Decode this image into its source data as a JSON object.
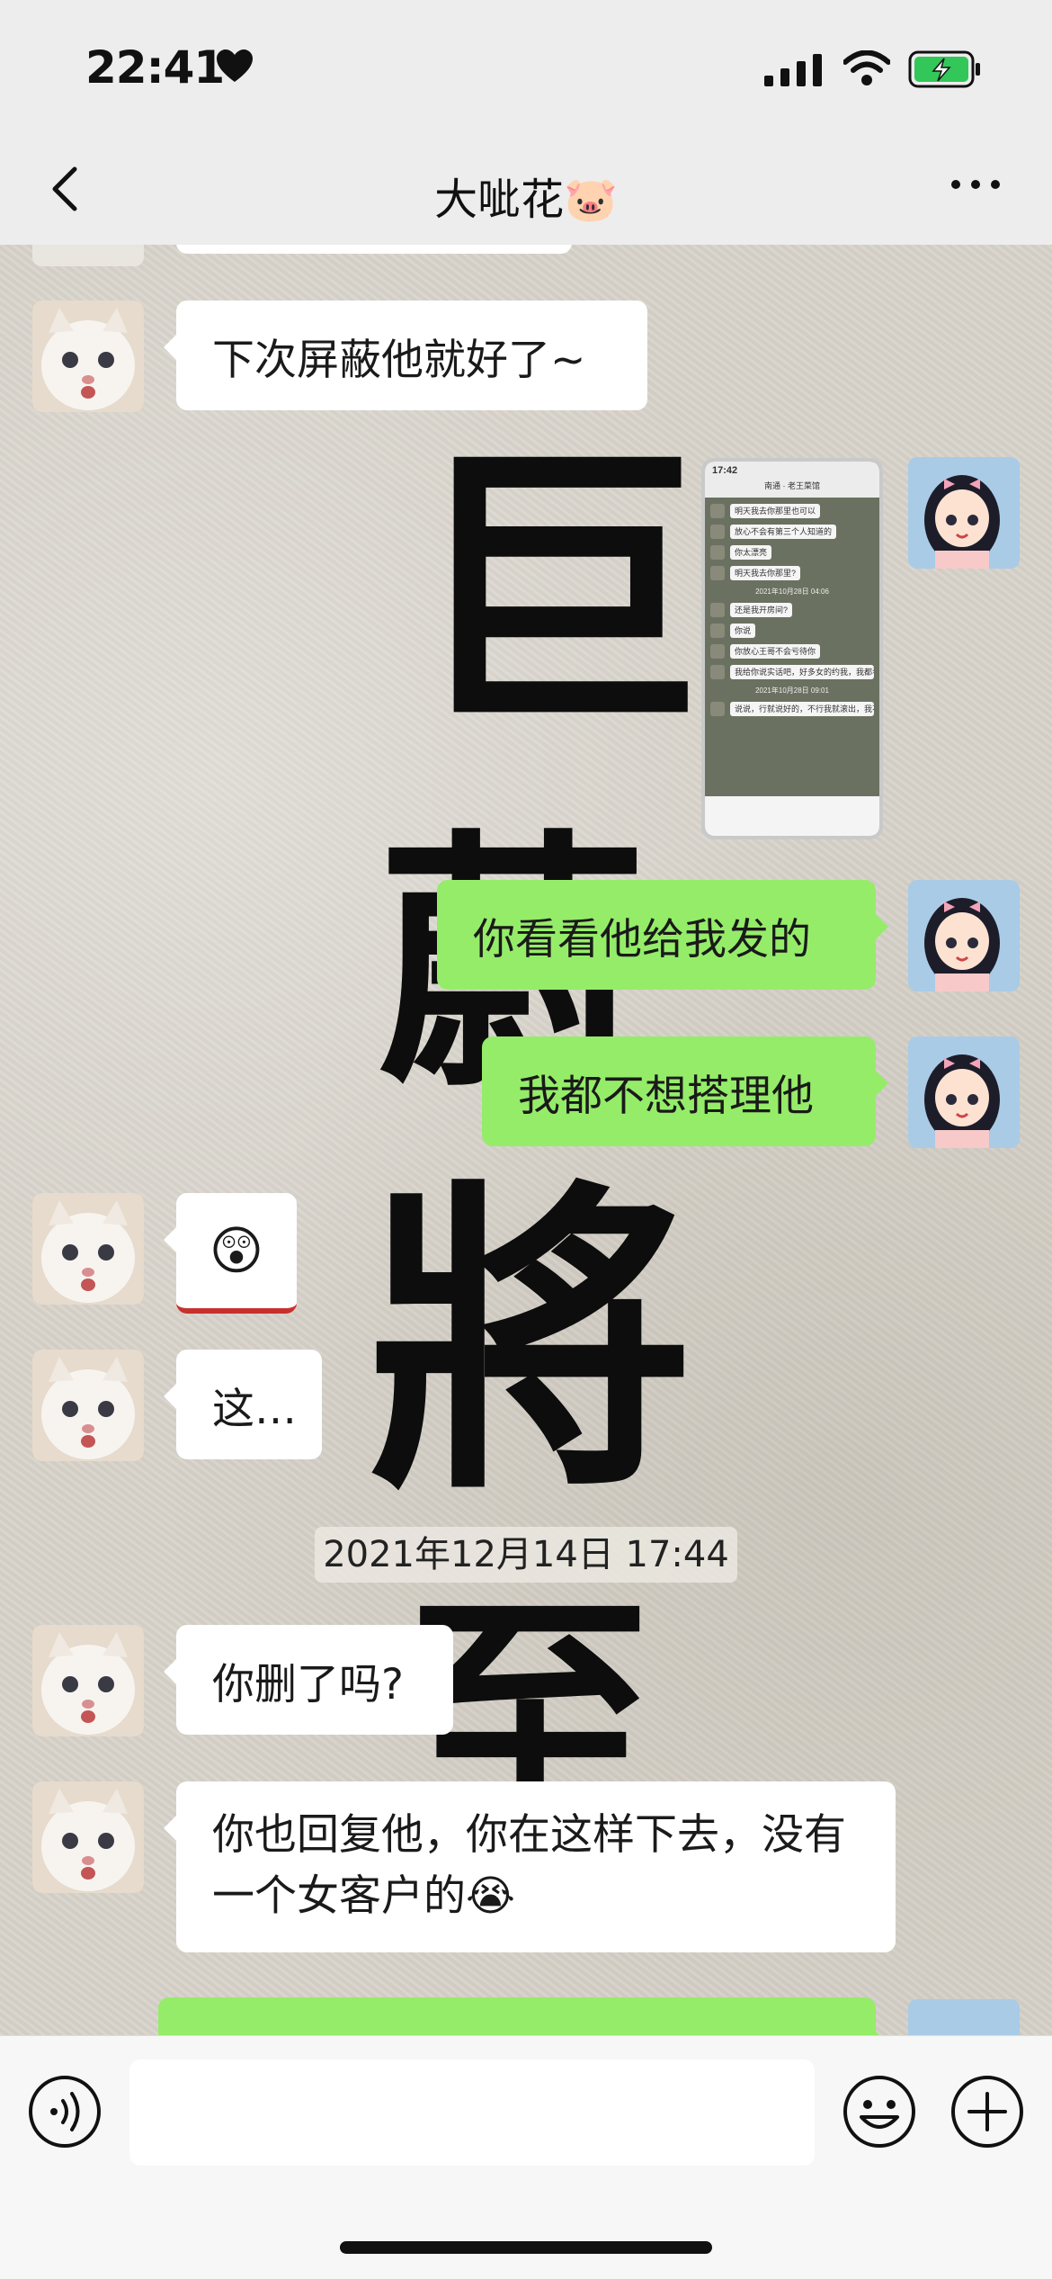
{
  "status_bar": {
    "time": "22:41"
  },
  "header": {
    "title": "大呲花🐷"
  },
  "background_art": {
    "chars": [
      "巨",
      "蔚",
      "將",
      "至"
    ]
  },
  "messages": [
    {
      "side": "left",
      "type": "text",
      "text": "下次屏蔽他就好了~"
    },
    {
      "side": "right",
      "type": "image",
      "text": ""
    },
    {
      "side": "right",
      "type": "text",
      "text": "你看看他给我发的"
    },
    {
      "side": "right",
      "type": "text",
      "text": "我都不想搭理他"
    },
    {
      "side": "left",
      "type": "emoji",
      "text": "😲"
    },
    {
      "side": "left",
      "type": "text",
      "text": "这…"
    },
    {
      "side": "left",
      "type": "text",
      "text": "你删了吗?"
    },
    {
      "side": "left",
      "type": "text",
      "text": "你也回复他，你在这样下去，没有一个女客户的😭"
    }
  ],
  "timestamp": "2021年12月14日 17:44",
  "screenshot_thumb": {
    "time": "17:42",
    "title": "南通 · 老王菜馆",
    "lines": [
      "明天我去你那里也可以",
      "放心不会有第三个人知道的",
      "你太漂亮",
      "明天我去你那里?",
      "还是我开房间?",
      "你说",
      "你放心王哥不会亏待你",
      "我给你说实话吧，好多女的约我，我都看不上，就喜欢你",
      "说说，行就说好的，不行我就滚出，我不勉强"
    ],
    "stamps": [
      "2021年10月28日 04:06",
      "2021年10月28日 09:01"
    ]
  },
  "input": {
    "placeholder": ""
  },
  "colors": {
    "sent_bubble": "#95ec69",
    "received_bubble": "#ffffff",
    "chrome": "#ededed"
  },
  "icons": [
    "heart-icon",
    "signal-icon",
    "wifi-icon",
    "battery-charging-icon",
    "back-icon",
    "more-icon",
    "voice-icon",
    "emoji-icon",
    "plus-icon"
  ]
}
